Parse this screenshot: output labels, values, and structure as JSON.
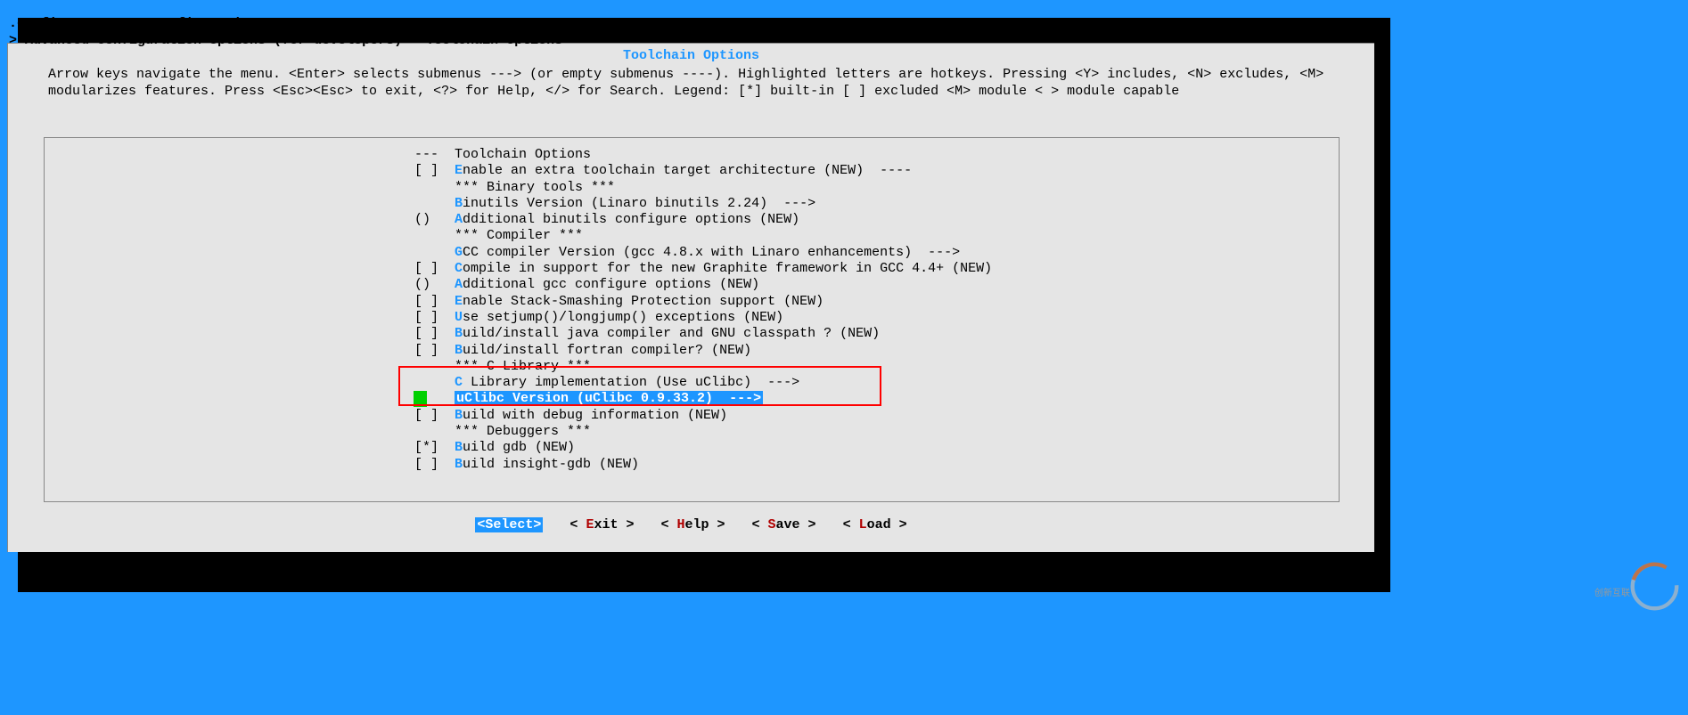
{
  "title_prefix": ".config - ",
  "title": "OpenWrt Configuration",
  "breadcrumb_prefix": "> ",
  "breadcrumb1": "Advanced configuration options (for developers)",
  "breadcrumb_sep": " > ",
  "breadcrumb2": "Toolchain Options",
  "panel_title": "Toolchain Options",
  "help_text": "Arrow keys navigate the menu.  <Enter> selects submenus ---> (or empty submenus ----).  Highlighted letters are hotkeys.  Pressing <Y> includes, <N> excludes, <M> modularizes features.  Press <Esc><Esc> to exit, <?> for Help, </> for Search.  Legend: [*] built-in  [ ] excluded  <M> module  < > module capable",
  "menu_items": [
    {
      "marker": "---",
      "hotkey": "",
      "text": "Toolchain Options",
      "suffix": ""
    },
    {
      "marker": "[ ]",
      "hotkey": "E",
      "text": "nable an extra toolchain target architecture (NEW)  ----",
      "suffix": ""
    },
    {
      "marker": "   ",
      "hotkey": "",
      "text": "*** Binary tools ***",
      "suffix": ""
    },
    {
      "marker": "   ",
      "hotkey": "B",
      "text": "inutils Version (Linaro binutils 2.24)  --->",
      "suffix": ""
    },
    {
      "marker": "() ",
      "hotkey": "A",
      "text": "dditional binutils configure options (NEW)",
      "suffix": ""
    },
    {
      "marker": "   ",
      "hotkey": "",
      "text": "*** Compiler ***",
      "suffix": ""
    },
    {
      "marker": "   ",
      "hotkey": "G",
      "text": "CC compiler Version (gcc 4.8.x with Linaro enhancements)  --->",
      "suffix": ""
    },
    {
      "marker": "[ ]",
      "hotkey": "C",
      "text": "ompile in support for the new Graphite framework in GCC 4.4+ (NEW)",
      "suffix": ""
    },
    {
      "marker": "() ",
      "hotkey": "A",
      "text": "dditional gcc configure options (NEW)",
      "suffix": ""
    },
    {
      "marker": "[ ]",
      "hotkey": "E",
      "text": "nable Stack-Smashing Protection support (NEW)",
      "suffix": ""
    },
    {
      "marker": "[ ]",
      "hotkey": "U",
      "text": "se setjump()/longjump() exceptions (NEW)",
      "suffix": ""
    },
    {
      "marker": "[ ]",
      "hotkey": "B",
      "text": "uild/install java compiler and GNU classpath ? (NEW)",
      "suffix": ""
    },
    {
      "marker": "[ ]",
      "hotkey": "B",
      "text": "uild/install fortran compiler? (NEW)",
      "suffix": ""
    },
    {
      "marker": "   ",
      "hotkey": "",
      "text": "*** C Library ***",
      "suffix": ""
    },
    {
      "marker": "   ",
      "hotkey": "C",
      "text": " Library implementation (Use uClibc)  --->",
      "suffix": ""
    },
    {
      "marker": "   ",
      "hotkey": "u",
      "text": "Clibc Version (uClibc 0.9.33.2)  --->",
      "suffix": "",
      "selected": true
    },
    {
      "marker": "[ ]",
      "hotkey": "B",
      "text": "uild with debug information (NEW)",
      "suffix": ""
    },
    {
      "marker": "   ",
      "hotkey": "",
      "text": "*** Debuggers ***",
      "suffix": ""
    },
    {
      "marker": "[*]",
      "hotkey": "B",
      "text": "uild gdb (NEW)",
      "suffix": ""
    },
    {
      "marker": "[ ]",
      "hotkey": "B",
      "text": "uild insight-gdb (NEW)",
      "suffix": ""
    }
  ],
  "buttons": [
    {
      "pre": "<",
      "hotkey": "S",
      "text": "elect>",
      "selected": true
    },
    {
      "pre": "< ",
      "hotkey": "E",
      "text": "xit >",
      "selected": false
    },
    {
      "pre": "< ",
      "hotkey": "H",
      "text": "elp >",
      "selected": false
    },
    {
      "pre": "< ",
      "hotkey": "S",
      "text": "ave >",
      "selected": false
    },
    {
      "pre": "< ",
      "hotkey": "L",
      "text": "oad >",
      "selected": false
    }
  ],
  "watermark_text": "创新互联"
}
